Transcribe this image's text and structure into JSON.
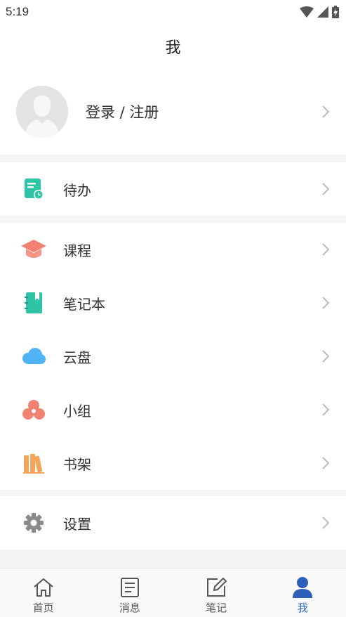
{
  "status_bar": {
    "time": "5:19"
  },
  "header": {
    "title": "我"
  },
  "profile": {
    "login_label": "登录 / 注册"
  },
  "sections": [
    {
      "items": [
        {
          "label": "待办",
          "icon": "todo-icon",
          "color": "#2ec4a6"
        }
      ]
    },
    {
      "items": [
        {
          "label": "课程",
          "icon": "graduation-cap-icon",
          "color": "#f2826f"
        },
        {
          "label": "笔记本",
          "icon": "notebook-icon",
          "color": "#2ec4a6"
        },
        {
          "label": "云盘",
          "icon": "cloud-icon",
          "color": "#4fb3f6"
        },
        {
          "label": "小组",
          "icon": "group-icon",
          "color": "#f2826f"
        },
        {
          "label": "书架",
          "icon": "bookshelf-icon",
          "color": "#f3a65a"
        }
      ]
    },
    {
      "items": [
        {
          "label": "设置",
          "icon": "gear-icon",
          "color": "#8a8a8a"
        }
      ]
    }
  ],
  "tabbar": {
    "tabs": [
      {
        "label": "首页",
        "icon": "home-icon",
        "active": false
      },
      {
        "label": "消息",
        "icon": "message-icon",
        "active": false
      },
      {
        "label": "笔记",
        "icon": "note-edit-icon",
        "active": false
      },
      {
        "label": "我",
        "icon": "user-icon",
        "active": true
      }
    ],
    "active_color": "#2b6cc4"
  }
}
